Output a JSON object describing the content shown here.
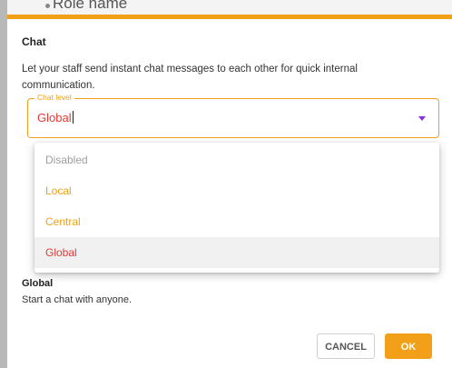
{
  "background": {
    "heading": "Role name"
  },
  "dialog": {
    "title": "Chat",
    "description": "Let your staff send instant chat messages to each other for quick internal communication.",
    "accent_color": "#f2a019"
  },
  "select": {
    "legend": "Chat level",
    "value": "Global",
    "options": [
      {
        "label": "Disabled",
        "state": "disabled"
      },
      {
        "label": "Local",
        "state": "normal"
      },
      {
        "label": "Central",
        "state": "normal"
      },
      {
        "label": "Global",
        "state": "selected"
      }
    ]
  },
  "section": {
    "title": "Global",
    "description": "Start a chat with anyone."
  },
  "buttons": {
    "cancel": "CANCEL",
    "ok": "OK"
  },
  "colors": {
    "accent": "#f2a019",
    "selected_text": "#e53935",
    "dropdown_arrow": "#8a2be2"
  }
}
